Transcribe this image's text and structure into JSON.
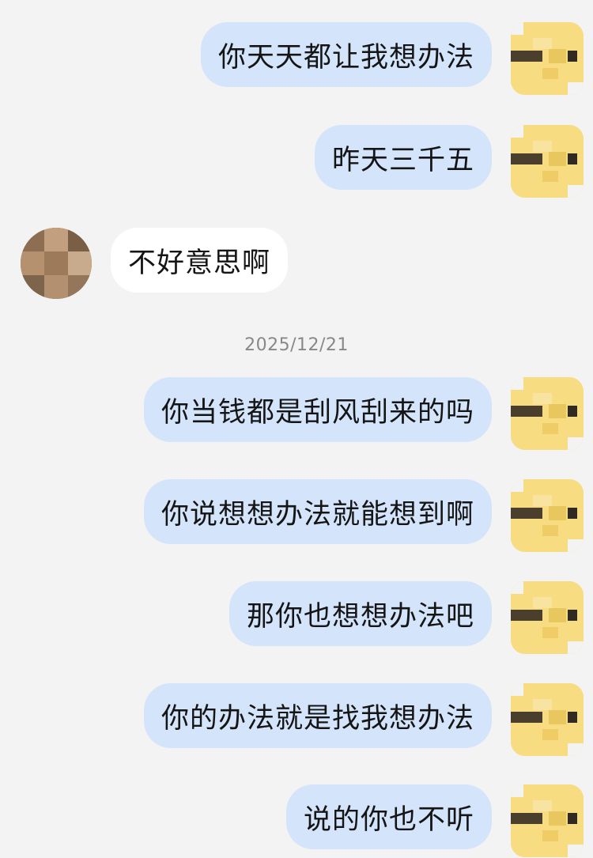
{
  "conversation": {
    "messages_before": [
      {
        "sender": "me",
        "text": "你天天都让我想办法"
      },
      {
        "sender": "me",
        "text": "昨天三千五"
      },
      {
        "sender": "other",
        "text": "不好意思啊"
      }
    ],
    "timestamp": "2025/12/21",
    "messages_after": [
      {
        "sender": "me",
        "text": "你当钱都是刮风刮来的吗"
      },
      {
        "sender": "me",
        "text": "你说想想办法就能想到啊"
      },
      {
        "sender": "me",
        "text": "那你也想想办法吧"
      },
      {
        "sender": "me",
        "text": "你的办法就是找我想办法"
      },
      {
        "sender": "me",
        "text": "说的你也不听"
      }
    ]
  },
  "colors": {
    "background": "#f3f3f3",
    "my_bubble": "#d4e4fa",
    "other_bubble": "#ffffff",
    "timestamp_text": "#888888"
  }
}
